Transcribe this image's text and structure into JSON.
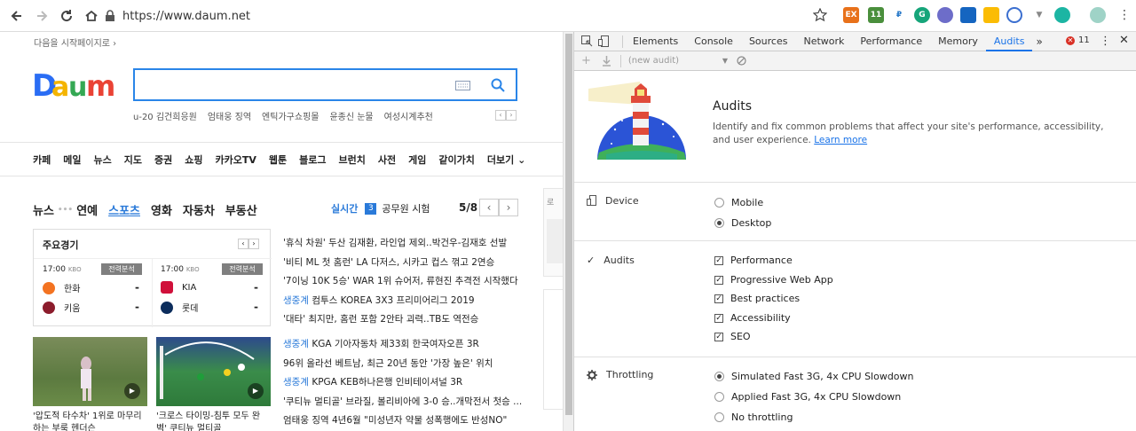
{
  "browser": {
    "url": "https://www.daum.net",
    "extensions": [
      "EX",
      "11",
      "₽",
      "G",
      "",
      "",
      "",
      "",
      "",
      "",
      "",
      ""
    ]
  },
  "daum": {
    "startpage": "다음을 시작페이지로",
    "logo": "Daum",
    "suggestions": [
      "u-20 김건희응원",
      "엄태웅 징역",
      "엔틱가구쇼핑몰",
      "윤종신 눈물",
      "여성시계추천"
    ],
    "menu": [
      "카페",
      "메일",
      "뉴스",
      "지도",
      "증권",
      "쇼핑",
      "카카오TV",
      "웹툰",
      "블로그",
      "브런치",
      "사전",
      "게임",
      "같이가치",
      "더보기"
    ],
    "news_tabs": [
      "뉴스",
      "연예",
      "스포츠",
      "영화",
      "자동차",
      "부동산"
    ],
    "realtime_label": "실시간",
    "realtime_rank": "3",
    "realtime_text": "공무원 시험",
    "page_indicator": "5/8",
    "games": {
      "title": "주요경기",
      "game1": {
        "time": "17:00",
        "league": "KBO",
        "badge": "전력분석",
        "team1": "한화",
        "team2": "키움",
        "score1": "-",
        "score2": "-"
      },
      "game2": {
        "time": "17:00",
        "league": "KBO",
        "badge": "전력분석",
        "team1": "KIA",
        "team2": "롯데",
        "score1": "-",
        "score2": "-"
      }
    },
    "headlines1": [
      "'휴식 차원' 두산 김재환, 라인업 제외..박건우-김재호 선발",
      "'비티 ML 첫 홈런' LA 다저스, 시카고 컵스 꺾고 2연승",
      "'7이닝 10K 5승' WAR 1위 슈어저, 류현진 추격전 시작했다",
      "생중계|컴투스 KOREA 3X3 프리미어리그 2019",
      "'대타' 최지만, 홈런 포함 2안타 괴력..TB도 역전승"
    ],
    "headlines2": [
      "생중계|KGA 기아자동차 제33회 한국여자오픈 3R",
      "96위 올라선 베트남, 최근 20년 동안 '가장 높은' 위치",
      "생중계|KPGA KEB하나은행 인비테이셔널 3R",
      "'쿠티뉴 멀티골' 브라질, 볼리비아에 3-0 승..개막전서 첫승 ...",
      "엄태웅 징역 4년6월 \"미성년자 약물 성폭행에도 반성NO\""
    ],
    "caption1": "'압도적 타수차' 1위로 마무리하는 부룩 헨더슨",
    "caption2": "'크로스 타이밍-침투 모두 완벽' 쿠티뉴 멀티골",
    "side_label": "로"
  },
  "devtools": {
    "tabs": [
      "Elements",
      "Console",
      "Sources",
      "Network",
      "Performance",
      "Memory",
      "Audits"
    ],
    "error_count": "11",
    "audit_select": "(new audit)",
    "title": "Audits",
    "description": "Identify and fix common problems that affect your site's performance, accessibility, and user experience.",
    "learn_more": "Learn more",
    "device_label": "Device",
    "device_options": [
      "Mobile",
      "Desktop"
    ],
    "audits_label": "Audits",
    "audit_options": [
      "Performance",
      "Progressive Web App",
      "Best practices",
      "Accessibility",
      "SEO"
    ],
    "throttling_label": "Throttling",
    "throttling_options": [
      "Simulated Fast 3G, 4x CPU Slowdown",
      "Applied Fast 3G, 4x CPU Slowdown",
      "No throttling"
    ]
  },
  "colors": {
    "accent": "#1a73e8",
    "daum_blue": "#3c6cf0",
    "devtools_bg": "#f3f3f3"
  }
}
